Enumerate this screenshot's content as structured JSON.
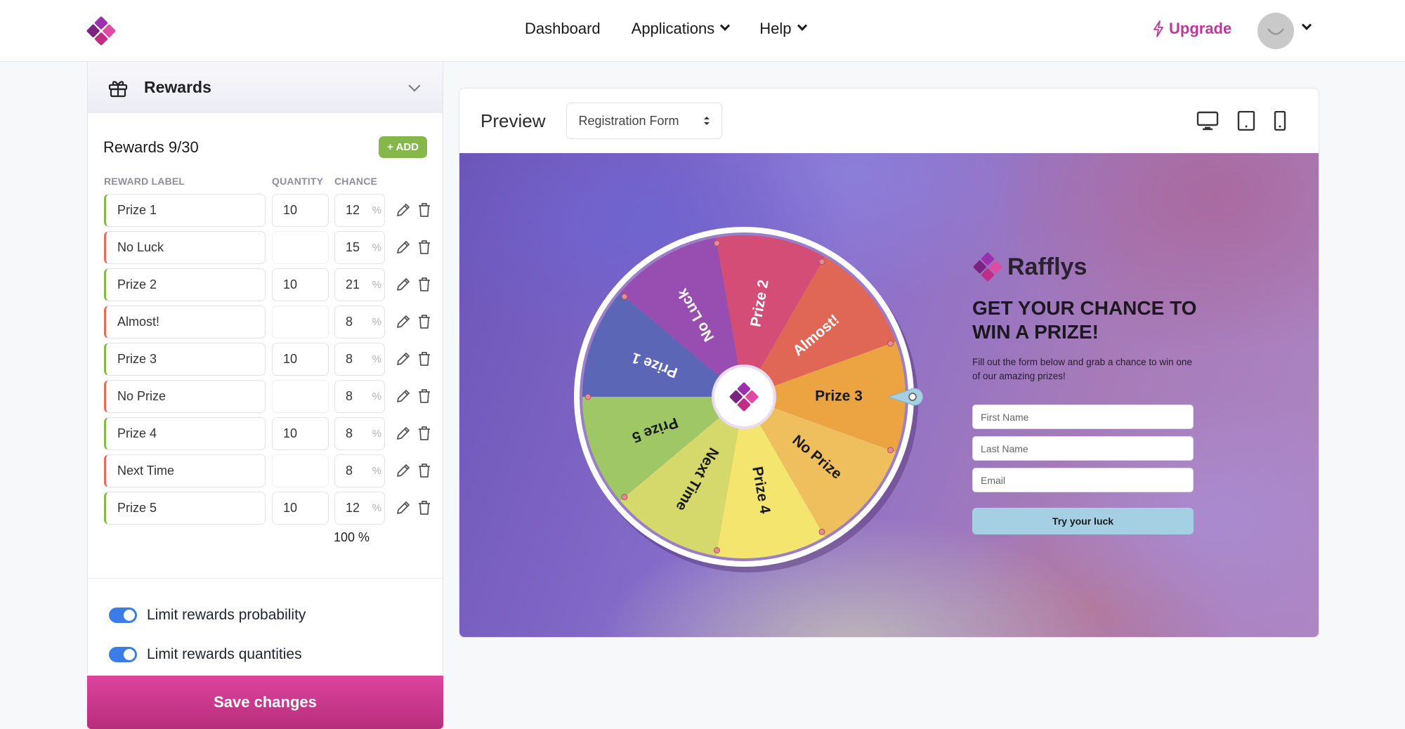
{
  "nav": {
    "items": [
      {
        "label": "Dashboard",
        "has_dropdown": false
      },
      {
        "label": "Applications",
        "has_dropdown": true
      },
      {
        "label": "Help",
        "has_dropdown": true
      }
    ],
    "upgrade_label": "Upgrade",
    "icons": {
      "logo": "rafflys-logo",
      "upgrade": "lightning-icon",
      "avatar": "smiley-avatar",
      "avatar_menu": "chevron-down-icon"
    }
  },
  "panel": {
    "section_title": "Rewards",
    "section_icon": "gift-icon",
    "rewards_count": "Rewards 9/30",
    "add_label": "+ ADD",
    "columns": {
      "label": "REWARD LABEL",
      "quantity": "QUANTITY",
      "chance": "CHANCE"
    },
    "rewards": [
      {
        "label": "Prize 1",
        "quantity": "10",
        "chance": "12",
        "type": "win"
      },
      {
        "label": "No Luck",
        "quantity": "",
        "chance": "15",
        "type": "lose"
      },
      {
        "label": "Prize 2",
        "quantity": "10",
        "chance": "21",
        "type": "win"
      },
      {
        "label": "Almost!",
        "quantity": "",
        "chance": "8",
        "type": "lose"
      },
      {
        "label": "Prize 3",
        "quantity": "10",
        "chance": "8",
        "type": "win"
      },
      {
        "label": "No Prize",
        "quantity": "",
        "chance": "8",
        "type": "lose"
      },
      {
        "label": "Prize 4",
        "quantity": "10",
        "chance": "8",
        "type": "win"
      },
      {
        "label": "Next Time",
        "quantity": "",
        "chance": "8",
        "type": "lose"
      },
      {
        "label": "Prize 5",
        "quantity": "10",
        "chance": "12",
        "type": "win"
      }
    ],
    "percent_symbol": "%",
    "total": "100 %",
    "toggles": [
      {
        "label": "Limit rewards probability",
        "on": true
      },
      {
        "label": "Limit rewards quantities",
        "on": true
      }
    ],
    "save_label": "Save changes",
    "colors": {
      "win": "#86b74a",
      "lose": "#e86a5d",
      "save": "#d23f95",
      "add": "#86b74a",
      "toggle": "#3a7de8"
    }
  },
  "preview": {
    "title": "Preview",
    "select_value": "Registration Form",
    "device_icons": [
      "desktop-icon",
      "tablet-icon",
      "mobile-icon"
    ],
    "wheel": {
      "segments": [
        {
          "label": "Prize 3",
          "color": "#eca443",
          "text_color": "#1a1a1a"
        },
        {
          "label": "No Prize",
          "color": "#efbf5d",
          "text_color": "#1a1a1a"
        },
        {
          "label": "Prize 4",
          "color": "#f3e56d",
          "text_color": "#1a1a1a"
        },
        {
          "label": "Next Time",
          "color": "#d5d96b",
          "text_color": "#1a1a1a"
        },
        {
          "label": "Prize 5",
          "color": "#9fc765",
          "text_color": "#1a1a1a"
        },
        {
          "label": "Prize 1",
          "color": "#5b67b6",
          "text_color": "#ffffff"
        },
        {
          "label": "No Luck",
          "color": "#984db1",
          "text_color": "#ffffff"
        },
        {
          "label": "Prize 2",
          "color": "#d34d77",
          "text_color": "#ffffff"
        },
        {
          "label": "Almost!",
          "color": "#e06655",
          "text_color": "#ffffff"
        }
      ],
      "pointer_color": "#a5d0e3"
    },
    "brand": "Rafflys",
    "headline": "GET YOUR CHANCE TO WIN A PRIZE!",
    "subtext": "Fill out the form below and grab a chance to win one of our amazing prizes!",
    "fields": [
      {
        "placeholder": "First Name"
      },
      {
        "placeholder": "Last Name"
      },
      {
        "placeholder": "Email"
      }
    ],
    "cta_label": "Try your luck"
  }
}
